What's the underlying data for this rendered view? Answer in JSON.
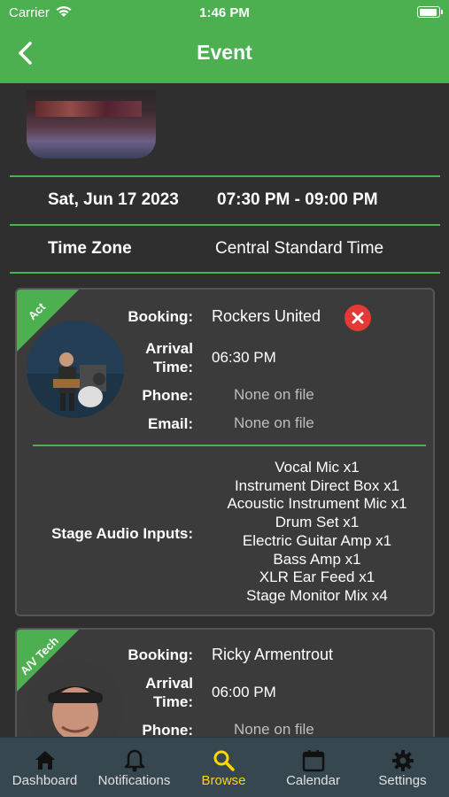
{
  "status": {
    "carrier": "Carrier",
    "time": "1:46 PM"
  },
  "header": {
    "title": "Event"
  },
  "event": {
    "date": "Sat, Jun 17 2023",
    "time_range": "07:30 PM - 09:00 PM",
    "time_zone_label": "Time Zone",
    "time_zone": "Central Standard Time"
  },
  "acts": [
    {
      "ribbon": "Act",
      "booking_label": "Booking:",
      "booking": "Rockers United",
      "arrival_label_1": "Arrival",
      "arrival_label_2": "Time:",
      "arrival_time": "06:30 PM",
      "phone_label": "Phone:",
      "phone": "None on file",
      "email_label": "Email:",
      "email": "None on file",
      "stage_label": "Stage Audio Inputs:",
      "stage_inputs": [
        "Vocal Mic x1",
        "Instrument Direct Box x1",
        "Acoustic Instrument Mic x1",
        "Drum Set x1",
        "Electric Guitar Amp x1",
        "Bass Amp x1",
        "XLR Ear Feed x1",
        "Stage Monitor Mix x4"
      ]
    },
    {
      "ribbon": "A/V Tech",
      "booking_label": "Booking:",
      "booking": "Ricky Armentrout",
      "arrival_label_1": "Arrival",
      "arrival_label_2": "Time:",
      "arrival_time": "06:00 PM",
      "phone_label": "Phone:",
      "phone": "None on file"
    }
  ],
  "tabs": [
    {
      "label": "Dashboard",
      "icon": "home-icon"
    },
    {
      "label": "Notifications",
      "icon": "bell-icon"
    },
    {
      "label": "Browse",
      "icon": "search-icon"
    },
    {
      "label": "Calendar",
      "icon": "calendar-icon"
    },
    {
      "label": "Settings",
      "icon": "gear-icon"
    }
  ],
  "colors": {
    "accent": "#4caf50",
    "active_tab": "#ffd600",
    "tabbar": "#37474f",
    "remove": "#e53935"
  }
}
